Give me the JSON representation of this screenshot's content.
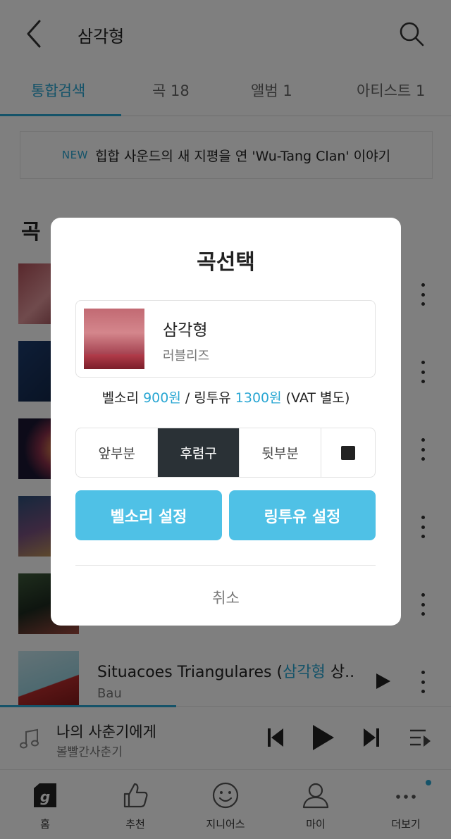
{
  "header": {
    "title": "삼각형"
  },
  "tabs": [
    {
      "label": "통합검색"
    },
    {
      "label": "곡 18"
    },
    {
      "label": "앨범 1"
    },
    {
      "label": "아티스트 1"
    }
  ],
  "banner": {
    "badge": "NEW",
    "text": "힙합 사운드의 새 지평을 연 'Wu-Tang Clan' 이야기"
  },
  "section": {
    "title": "곡"
  },
  "songs": [
    {
      "title": "",
      "title_highlight": "",
      "title_rest": "",
      "artist": ""
    },
    {
      "title": "",
      "title_highlight": "",
      "title_rest": "",
      "artist": ""
    },
    {
      "title": "",
      "title_highlight": "",
      "title_rest": "",
      "artist": ""
    },
    {
      "title": "",
      "title_highlight": "",
      "title_rest": "",
      "artist": ""
    },
    {
      "title": "",
      "title_highlight": "",
      "title_rest": "",
      "artist": ""
    },
    {
      "title": "Situacoes Triangulares (",
      "title_highlight": "삼각형",
      "title_rest": " 상..",
      "artist": "Bau"
    }
  ],
  "player": {
    "title": "나의 사춘기에게",
    "artist": "볼빨간사춘기",
    "progress": 0.39
  },
  "nav": [
    {
      "label": "홈"
    },
    {
      "label": "추천"
    },
    {
      "label": "지니어스"
    },
    {
      "label": "마이"
    },
    {
      "label": "더보기"
    }
  ],
  "modal": {
    "title": "곡선택",
    "song_title": "삼각형",
    "song_artist": "러블리즈",
    "price_bell_label": "벨소리 ",
    "price_bell": "900원",
    "price_sep": " / 링투유 ",
    "price_ring": "1300원",
    "price_vat": " (VAT 별도)",
    "segments": [
      "앞부분",
      "후렴구",
      "뒷부분"
    ],
    "active_segment": "후렴구",
    "bell_button": "벨소리 설정",
    "ring_button": "링투유 설정",
    "cancel": "취소"
  },
  "colors": {
    "accent": "#2aa7d3",
    "button": "#4fc1e6",
    "segment_active": "#2a3136"
  }
}
